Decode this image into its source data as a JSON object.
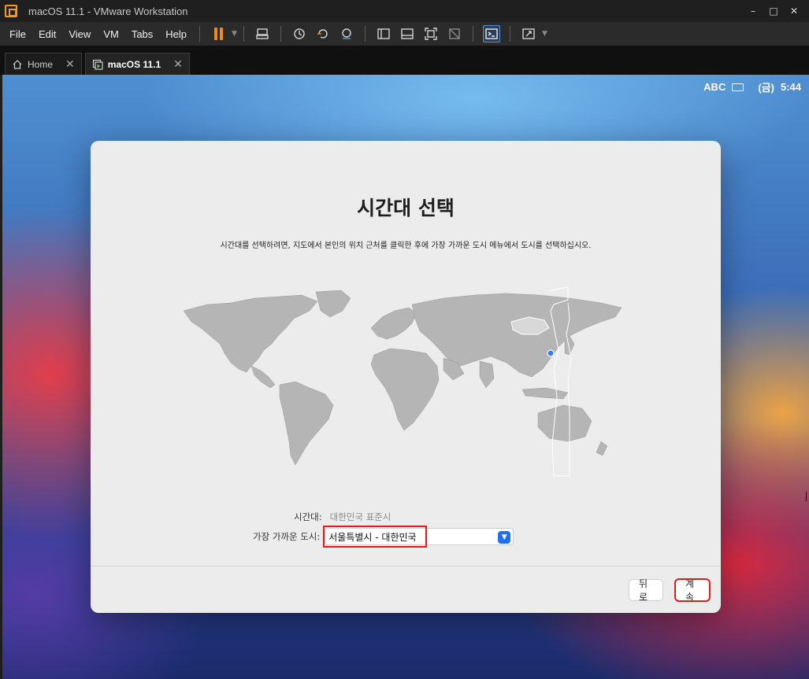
{
  "window": {
    "title": "macOS 11.1 - VMware Workstation",
    "controls": {
      "minimize": "–",
      "maximize": "□",
      "close": "✕"
    }
  },
  "menu": {
    "items": [
      "File",
      "Edit",
      "View",
      "VM",
      "Tabs",
      "Help"
    ]
  },
  "toolbar": {
    "icons": [
      "pause-icon",
      "send-keys-icon",
      "snapshot-icon",
      "revert-snapshot-icon",
      "snapshot-manager-icon",
      "sidebar-icon",
      "thumbnail-bar-icon",
      "full-screen-icon",
      "unity-icon",
      "console-view-icon",
      "stretch-icon"
    ]
  },
  "tabs": [
    {
      "label": "Home",
      "icon": "home-icon",
      "active": false
    },
    {
      "label": "macOS 11.1",
      "icon": "vm-icon",
      "active": true
    }
  ],
  "mac_status": {
    "input_source": "ABC",
    "day": "(금)",
    "time": "5:44"
  },
  "dialog": {
    "title": "시간대 선택",
    "description": "시간대를 선택하려면, 지도에서 본인의 위치 근처를 클릭한 후에 가장 가까운 도시 메뉴에서 도시를 선택하십시오.",
    "timezone_label": "시간대:",
    "timezone_value": "대한민국 표준시",
    "city_label": "가장 가까운 도시:",
    "city_value": "서울특별시 - 대한민국",
    "back_label": "뒤로",
    "continue_label": "계속"
  },
  "colors": {
    "highlight": "#e21a1a",
    "accent": "#1f6ff2",
    "dialog_bg": "#ececec",
    "map_land": "#b5b5b5"
  }
}
